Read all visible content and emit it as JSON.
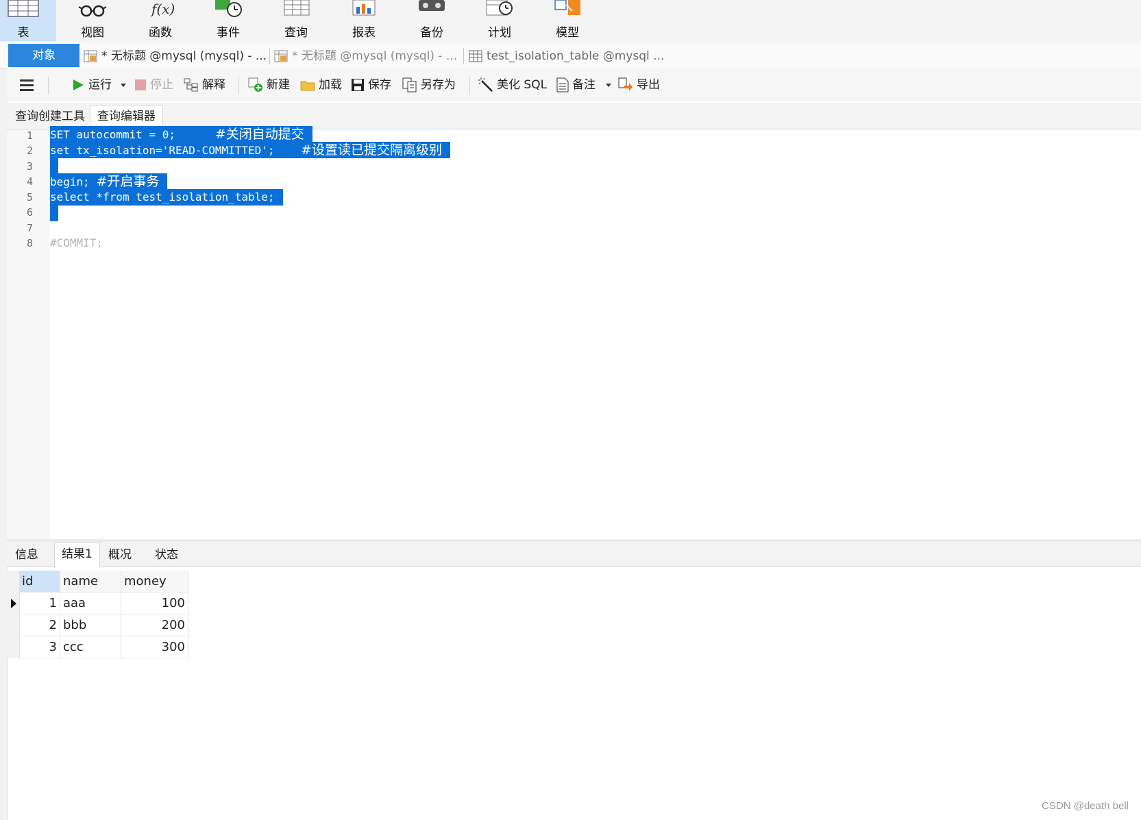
{
  "top_toolbar": {
    "items": [
      {
        "label": "表",
        "icon": "table-icon"
      },
      {
        "label": "视图",
        "icon": "glasses-icon"
      },
      {
        "label": "函数",
        "icon": "function-icon"
      },
      {
        "label": "事件",
        "icon": "event-clock-icon"
      },
      {
        "label": "查询",
        "icon": "query-icon"
      },
      {
        "label": "报表",
        "icon": "report-chart-icon"
      },
      {
        "label": "备份",
        "icon": "backup-icon"
      },
      {
        "label": "计划",
        "icon": "schedule-icon"
      },
      {
        "label": "模型",
        "icon": "model-icon"
      }
    ]
  },
  "tabs": {
    "objects": "对象",
    "items": [
      {
        "label": "* 无标题 @mysql (mysql) - ...",
        "icon": "query-tab-icon"
      },
      {
        "label": "* 无标题 @mysql (mysql) - ...",
        "icon": "query-tab-icon"
      },
      {
        "label": "test_isolation_table @mysql ...",
        "icon": "table-tab-icon"
      }
    ]
  },
  "query_toolbar": {
    "menu_icon": "hamburger-icon",
    "run": "运行",
    "stop": "停止",
    "explain": "解释",
    "new": "新建",
    "load": "加载",
    "save": "保存",
    "save_as": "另存为",
    "beautify": "美化 SQL",
    "comment": "备注",
    "export": "导出"
  },
  "sub_tabs": {
    "builder": "查询创建工具",
    "editor": "查询编辑器"
  },
  "editor": {
    "line_numbers": [
      "1",
      "2",
      "3",
      "4",
      "5",
      "6",
      "7",
      "8"
    ],
    "line1_code": "SET autocommit = 0;      ",
    "line1_comment": "#关闭自动提交",
    "line2_code": "set tx_isolation='READ-COMMITTED';    ",
    "line2_comment": "#设置读已提交隔离级别",
    "line4_code": "begin; ",
    "line4_comment": "#开启事务",
    "line5_code": "select *from test_isolation_table;",
    "line8_code": "#COMMIT;"
  },
  "result_tabs": {
    "info": "信息",
    "result1": "结果1",
    "overview": "概况",
    "status": "状态"
  },
  "result_grid": {
    "columns": [
      "id",
      "name",
      "money"
    ],
    "rows": [
      {
        "id": "1",
        "name": "aaa",
        "money": "100"
      },
      {
        "id": "2",
        "name": "bbb",
        "money": "200"
      },
      {
        "id": "3",
        "name": "ccc",
        "money": "300"
      }
    ]
  },
  "watermark": "CSDN @death bell",
  "colors": {
    "accent": "#2b87dc",
    "selection": "#0a6fd6",
    "active_tool": "#cde3f7"
  }
}
